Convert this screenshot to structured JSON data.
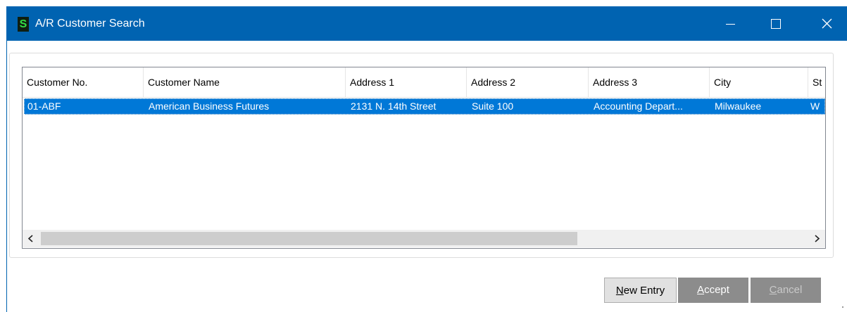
{
  "window": {
    "title": "A/R Customer Search",
    "app_icon_glyph": "S",
    "app_icon": "sage-s-icon",
    "accent_color": "#0063b1"
  },
  "grid": {
    "columns": [
      "Customer No.",
      "Customer Name",
      "Address 1",
      "Address 2",
      "Address 3",
      "City",
      "St"
    ],
    "rows": [
      {
        "cells": [
          "01-ABF",
          "American Business Futures",
          "2131 N. 14th Street",
          "Suite 100",
          "Accounting Depart...",
          "Milwaukee",
          "W"
        ],
        "selected": true
      }
    ],
    "selection_color": "#0078d7"
  },
  "buttons": {
    "new_entry": {
      "mnemonic": "N",
      "rest": "ew Entry"
    },
    "accept": {
      "mnemonic": "A",
      "rest": "ccept"
    },
    "cancel": {
      "mnemonic": "C",
      "rest": "ancel"
    }
  }
}
